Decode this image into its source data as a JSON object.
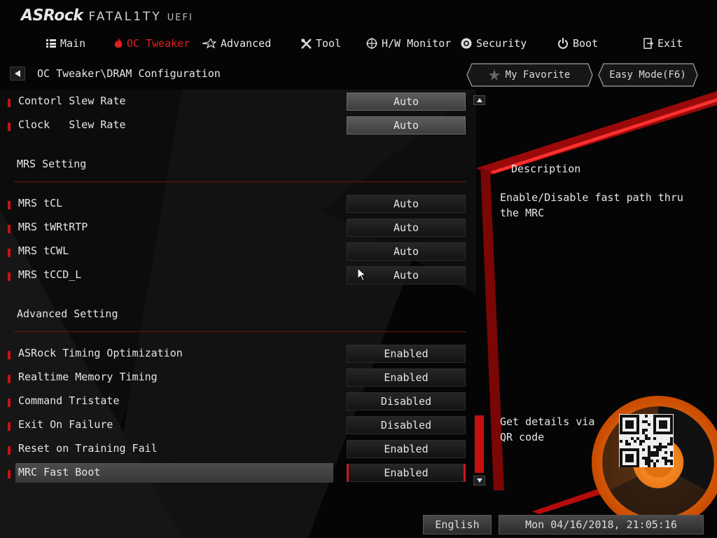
{
  "brand": {
    "name": "ASRock",
    "sub": "FATAL1TY",
    "uefi": "UEFI"
  },
  "nav": [
    {
      "label": "Main",
      "icon": "list-icon",
      "active": false
    },
    {
      "label": "OC Tweaker",
      "icon": "flame-icon",
      "active": true
    },
    {
      "label": "Advanced",
      "icon": "star-icon",
      "active": false
    },
    {
      "label": "Tool",
      "icon": "tools-icon",
      "active": false
    },
    {
      "label": "H/W Monitor",
      "icon": "crosshair-icon",
      "active": false
    },
    {
      "label": "Security",
      "icon": "badge-icon",
      "active": false
    },
    {
      "label": "Boot",
      "icon": "power-icon",
      "active": false
    },
    {
      "label": "Exit",
      "icon": "exit-icon",
      "active": false
    }
  ],
  "breadcrumb": "OC Tweaker\\DRAM Configuration",
  "buttons": {
    "favorite": "My Favorite",
    "easy_mode": "Easy Mode(F6)"
  },
  "settings": {
    "contorl_slew_rate": {
      "label": "Contorl Slew Rate",
      "value": "Auto"
    },
    "clock_slew_rate": {
      "label": "Clock   Slew Rate",
      "value": "Auto"
    },
    "mrs_section": "MRS Setting",
    "mrs_tcl": {
      "label": "MRS tCL",
      "value": "Auto"
    },
    "mrs_twrtrtp": {
      "label": "MRS tWRtRTP",
      "value": "Auto"
    },
    "mrs_tcwl": {
      "label": "MRS tCWL",
      "value": "Auto"
    },
    "mrs_tccd_l": {
      "label": "MRS tCCD_L",
      "value": "Auto"
    },
    "advanced_section": "Advanced Setting",
    "asrock_timing": {
      "label": "ASRock Timing Optimization",
      "value": "Enabled"
    },
    "realtime_memory": {
      "label": "Realtime Memory Timing",
      "value": "Enabled"
    },
    "command_tristate": {
      "label": "Command Tristate",
      "value": "Disabled"
    },
    "exit_on_failure": {
      "label": "Exit On Failure",
      "value": "Disabled"
    },
    "reset_training": {
      "label": "Reset on Training Fail",
      "value": "Enabled"
    },
    "mrc_fast_boot": {
      "label": "MRC Fast Boot",
      "value": "Enabled"
    }
  },
  "description": {
    "title": "Description",
    "text": "Enable/Disable fast path thru the MRC",
    "qr_text": "Get details via QR code"
  },
  "footer": {
    "language": "English",
    "datetime": "Mon 04/16/2018, 21:05:16"
  },
  "colors": {
    "accent": "#e0201c",
    "background": "#050505",
    "text": "#e6e6e6"
  }
}
